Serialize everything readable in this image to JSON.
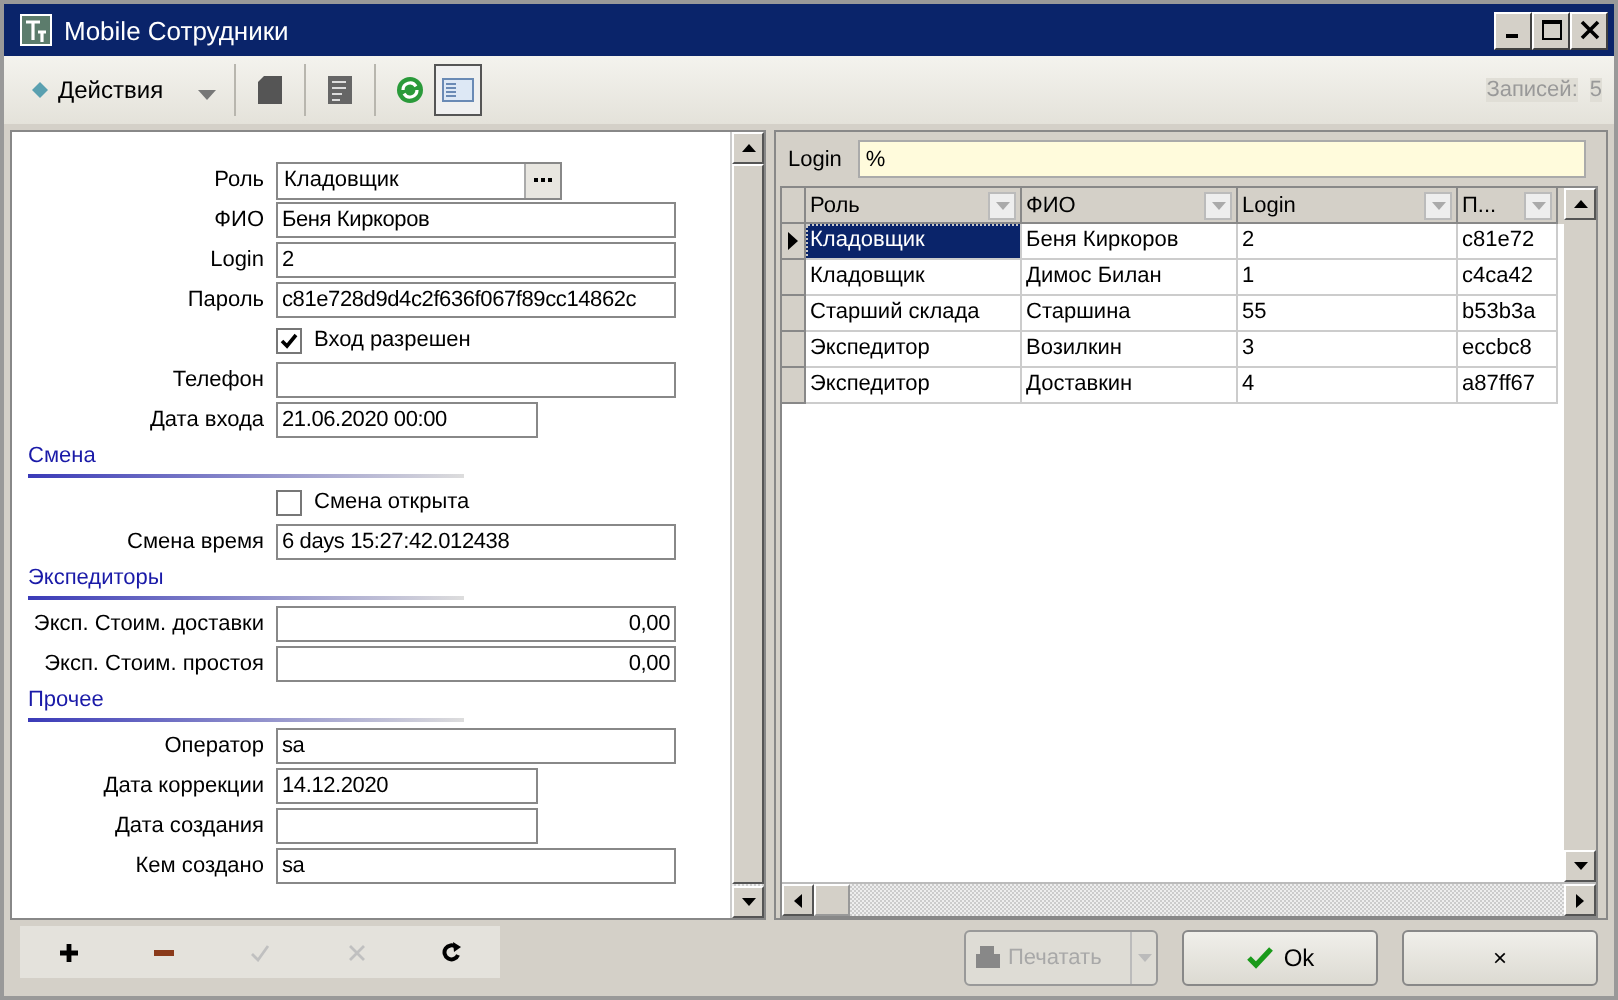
{
  "window": {
    "title": "Mobile Сотрудники"
  },
  "toolbar": {
    "actions_label": "Действия",
    "records_label": "Записей:",
    "records_count": "5",
    "layout_pressed": true
  },
  "form": [
    {
      "kind": "lookup",
      "label": "Роль",
      "value": "Кладовщик"
    },
    {
      "kind": "text",
      "label": "ФИО",
      "value": "Беня Киркоров"
    },
    {
      "kind": "text",
      "label": "Login",
      "value": "2"
    },
    {
      "kind": "text",
      "label": "Пароль",
      "value": "c81e728d9d4c2f636f067f89cc14862c"
    },
    {
      "kind": "checkbox",
      "label": "Вход разрешен",
      "checked": true
    },
    {
      "kind": "text",
      "label": "Телефон"
    },
    {
      "kind": "short",
      "label": "Дата входа",
      "value": "21.06.2020 00:00"
    },
    {
      "kind": "section",
      "label": "Смена"
    },
    {
      "kind": "checkbox",
      "label": "Смена открыта",
      "checked": false
    },
    {
      "kind": "text",
      "label": "Смена время",
      "value": "6 days 15:27:42.012438"
    },
    {
      "kind": "section",
      "label": "Экспедиторы"
    },
    {
      "kind": "number",
      "label": "Эксп. Стоим. доставки",
      "value": "0,00"
    },
    {
      "kind": "number",
      "label": "Эксп. Стоим. простоя",
      "value": "0,00"
    },
    {
      "kind": "section",
      "label": "Прочее"
    },
    {
      "kind": "text",
      "label": "Оператор",
      "value": "sa"
    },
    {
      "kind": "short",
      "label": "Дата коррекции",
      "value": "14.12.2020"
    },
    {
      "kind": "short",
      "label": "Дата создания"
    },
    {
      "kind": "text",
      "label": "Кем создано",
      "value": "sa"
    }
  ],
  "filter": {
    "label": "Login",
    "value": "%"
  },
  "table": {
    "columns": [
      "Роль",
      "ФИО",
      "Login",
      "П..."
    ],
    "rows": [
      {
        "selected": true,
        "cells": [
          "Кладовщик",
          "Беня Киркоров",
          "2",
          "c81e72"
        ]
      },
      {
        "selected": false,
        "cells": [
          "Кладовщик",
          "Димос Билан",
          "1",
          "c4ca42"
        ]
      },
      {
        "selected": false,
        "cells": [
          "Старший склада",
          "Старшина",
          "55",
          "b53b3a"
        ]
      },
      {
        "selected": false,
        "cells": [
          "Экспедитор",
          "Возилкин",
          "3",
          "eccbc8"
        ]
      },
      {
        "selected": false,
        "cells": [
          "Экспедитор",
          "Доставкин",
          "4",
          "a87ff67"
        ]
      }
    ]
  },
  "bottom_tools": [
    {
      "kind": "add",
      "disabled": false
    },
    {
      "kind": "remove",
      "disabled": false
    },
    {
      "kind": "confirm",
      "disabled": true
    },
    {
      "kind": "cancel",
      "disabled": true
    },
    {
      "kind": "refresh",
      "disabled": false
    }
  ],
  "buttons": [
    {
      "kind": "print",
      "label": "Печатать",
      "disabled": true
    },
    {
      "kind": "ok",
      "label": "Ok",
      "disabled": false
    },
    {
      "kind": "close",
      "label": "×",
      "disabled": false
    }
  ]
}
